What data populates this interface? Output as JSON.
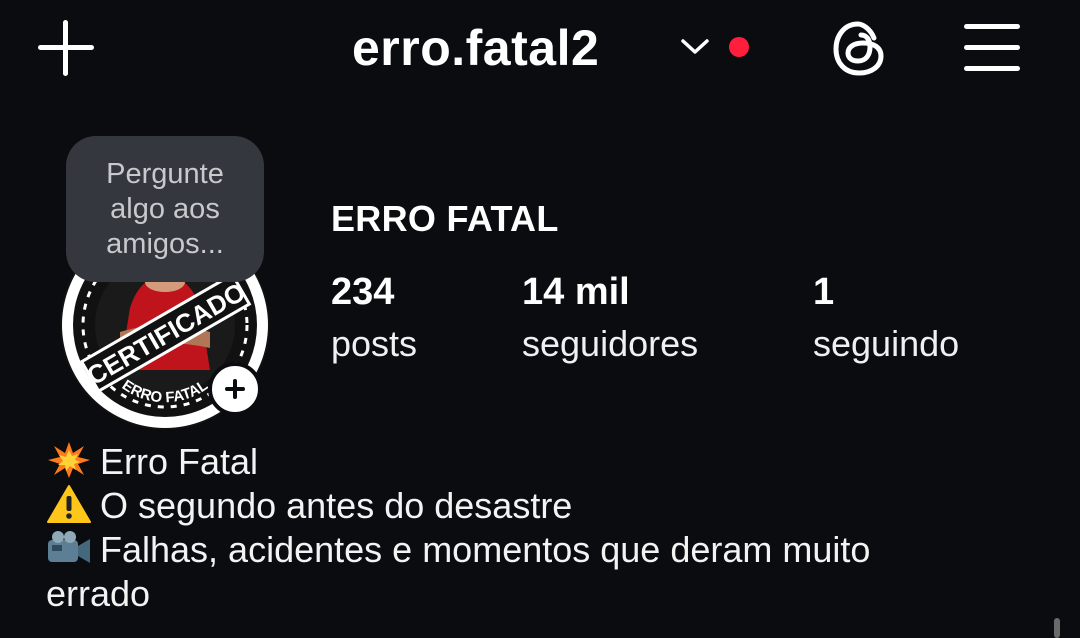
{
  "header": {
    "username": "erro.fatal2",
    "icons": {
      "create": "plus-icon",
      "switch": "chevron-down-icon",
      "threads": "threads-icon",
      "menu": "hamburger-menu-icon"
    },
    "notification_color": "#ff1f3d"
  },
  "note": {
    "lines": [
      "Pergunte",
      "algo aos",
      "amigos..."
    ]
  },
  "profile": {
    "display_name": "ERRO FATAL",
    "avatar_text": {
      "main": "CERTIFICADO",
      "sub": "ERRO FATAL"
    },
    "stats": [
      {
        "value": "234",
        "label": "posts"
      },
      {
        "value": "14 mil",
        "label": "seguidores"
      },
      {
        "value": "1",
        "label": "seguindo"
      }
    ]
  },
  "bio": {
    "lines": [
      {
        "icon": "collision-emoji",
        "text": "Erro Fatal"
      },
      {
        "icon": "warning-emoji",
        "text": "O segundo antes do desastre"
      },
      {
        "icon": "video-camera-emoji",
        "text": "Falhas, acidentes e momentos que deram muito"
      },
      {
        "icon": "",
        "text": "errado"
      }
    ]
  }
}
